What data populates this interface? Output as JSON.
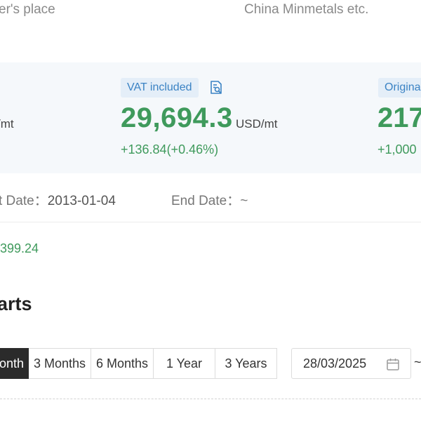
{
  "header": {
    "left_text": "er's place",
    "right_text": "China Minmetals etc."
  },
  "price_panel": {
    "left_unit": "/mt",
    "vat": {
      "badge": "VAT included",
      "icon": "document-search-icon",
      "price": "29,694.3",
      "unit": "USD/mt",
      "change": "+136.84(+0.46%)"
    },
    "original": {
      "badge": "Origina",
      "price": "217",
      "change": "+1,000"
    }
  },
  "dates": {
    "start_label": "t Date：",
    "start_value": "2013-01-04",
    "end_label": "End Date：",
    "end_value": "~"
  },
  "green_value": "399.24",
  "section_title": "arts",
  "range_buttons": [
    {
      "label": "onth",
      "active": true
    },
    {
      "label": "3 Months",
      "active": false
    },
    {
      "label": "6 Months",
      "active": false
    },
    {
      "label": "1 Year",
      "active": false
    },
    {
      "label": "3 Years",
      "active": false
    }
  ],
  "date_picker": {
    "value": "28/03/2025",
    "icon": "calendar-icon",
    "separator": "~"
  },
  "colors": {
    "green": "#3f9a5c",
    "badge_text": "#3b83c4",
    "badge_bg": "#e4eef8",
    "panel_bg": "#f5f8fb",
    "active_btn": "#2b2b2b"
  }
}
